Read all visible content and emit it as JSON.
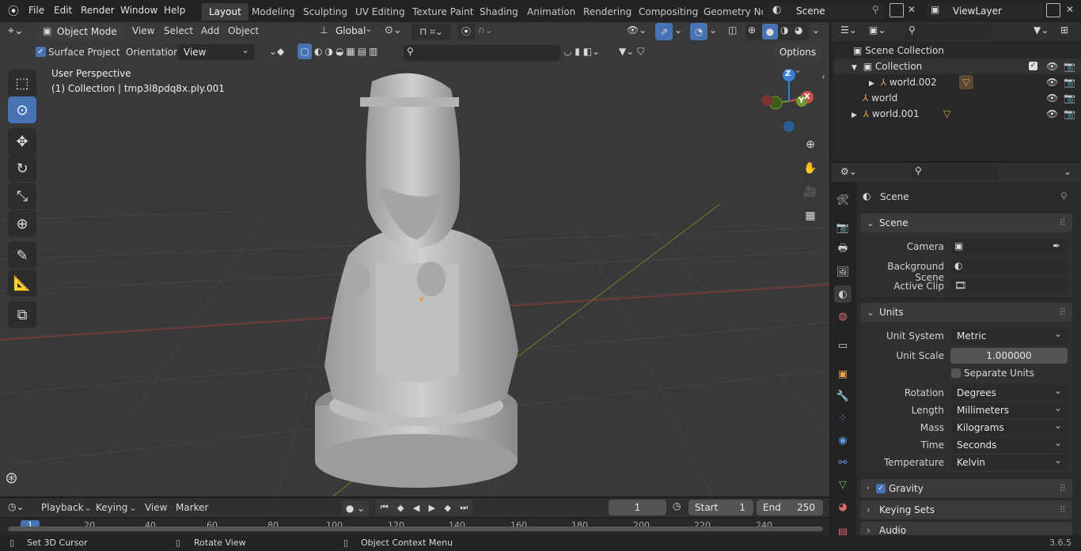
{
  "menu": [
    "File",
    "Edit",
    "Render",
    "Window",
    "Help"
  ],
  "workspaces": [
    "Layout",
    "Modeling",
    "Sculpting",
    "UV Editing",
    "Texture Paint",
    "Shading",
    "Animation",
    "Rendering",
    "Compositing",
    "Geometry Noc"
  ],
  "scene_name": "Scene",
  "view_layer": "ViewLayer",
  "viewport_header": {
    "mode": "Object Mode",
    "menus": [
      "View",
      "Select",
      "Add",
      "Object"
    ],
    "transform": "Global",
    "search_placeholder": ""
  },
  "tool_header": {
    "surface_project": "Surface Project",
    "orientation_label": "Orientation:",
    "orientation_value": "View",
    "options": "Options"
  },
  "viewport_info": {
    "line1": "User Perspective",
    "line2": "(1) Collection | tmp3l8pdq8x.ply.001"
  },
  "gizmo": {
    "x": "X",
    "y": "Y",
    "z": "Z"
  },
  "outliner": {
    "root": "Scene Collection",
    "items": [
      {
        "name": "Collection"
      },
      {
        "name": "world.002"
      },
      {
        "name": "world"
      },
      {
        "name": "world.001"
      }
    ]
  },
  "properties": {
    "context": "Scene",
    "scene_panel": "Scene",
    "camera_label": "Camera",
    "bg_scene_label": "Background Scene",
    "active_clip_label": "Active Clip",
    "units_panel": "Units",
    "unit_system_label": "Unit System",
    "unit_system": "Metric",
    "unit_scale_label": "Unit Scale",
    "unit_scale": "1.000000",
    "separate_units": "Separate Units",
    "rotation_label": "Rotation",
    "rotation": "Degrees",
    "length_label": "Length",
    "length": "Millimeters",
    "mass_label": "Mass",
    "mass": "Kilograms",
    "time_label": "Time",
    "time": "Seconds",
    "temperature_label": "Temperature",
    "temperature": "Kelvin",
    "gravity": "Gravity",
    "keying_sets": "Keying Sets",
    "audio": "Audio"
  },
  "timeline": {
    "menus": [
      "Playback",
      "Keying",
      "View",
      "Marker"
    ],
    "current_frame": "1",
    "start_label": "Start",
    "start": "1",
    "end_label": "End",
    "end": "250",
    "ticks": [
      "1",
      "20",
      "40",
      "60",
      "80",
      "100",
      "120",
      "140",
      "160",
      "180",
      "200",
      "220",
      "240"
    ]
  },
  "statusbar": {
    "left": "Set 3D Cursor",
    "middle": "Rotate View",
    "right": "Object Context Menu",
    "version": "3.6.5"
  },
  "colors": {
    "accent": "#4772b3",
    "bg": "#1d1d1d",
    "viewport": "#393939",
    "orange": "#e5a050"
  }
}
